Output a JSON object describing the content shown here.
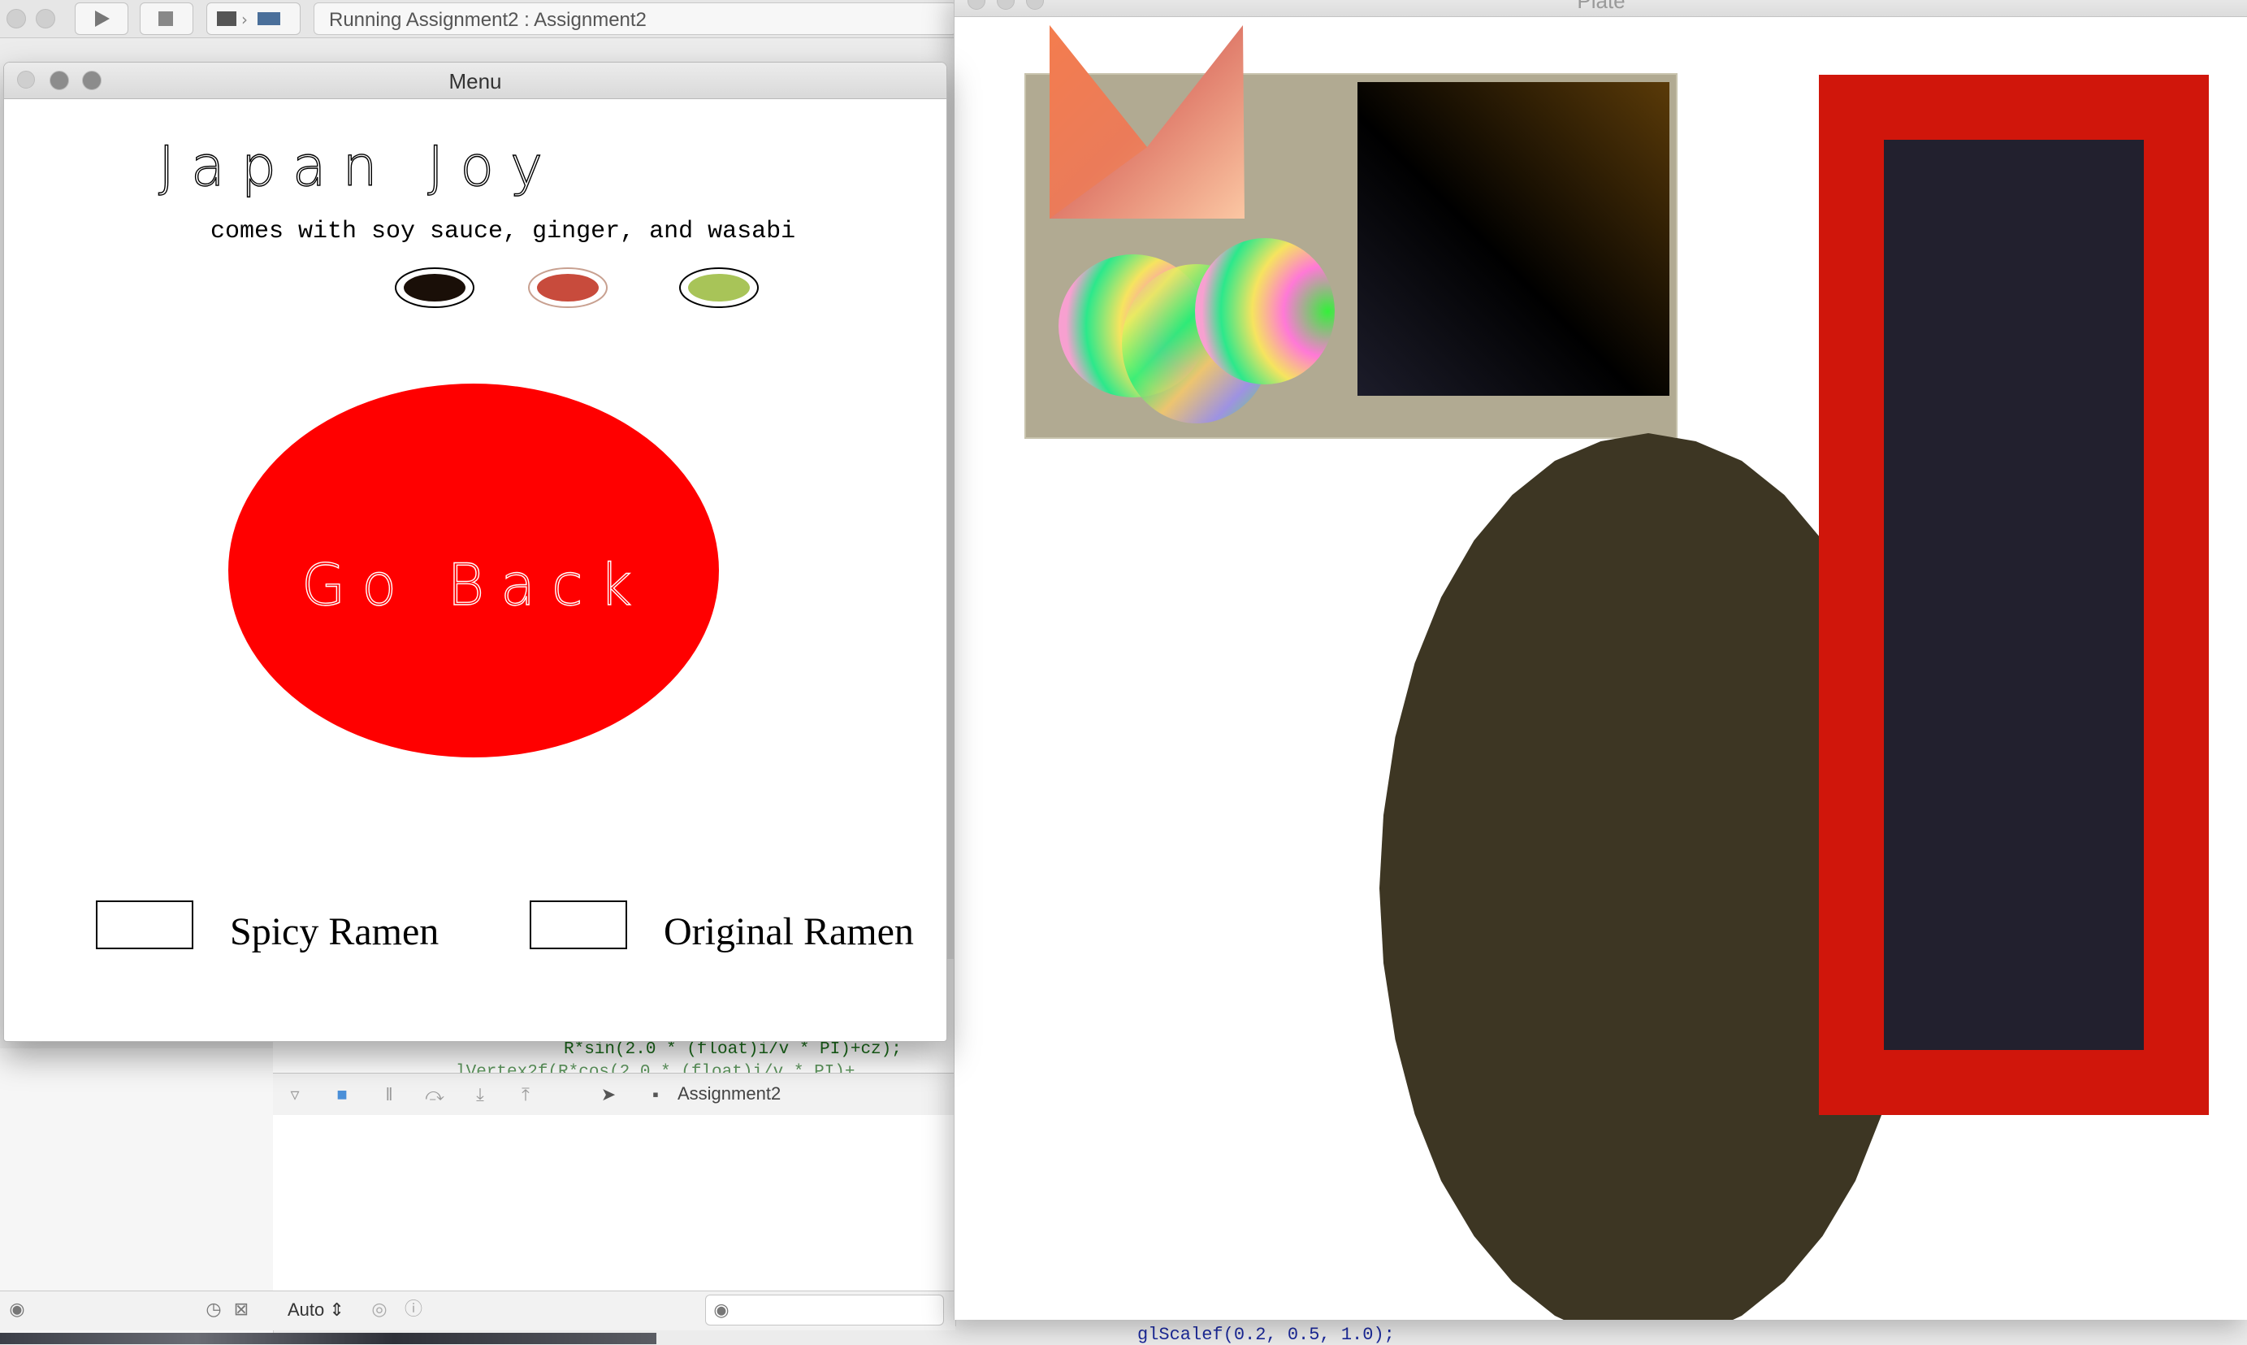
{
  "xcode": {
    "activity_text": "Running Assignment2 : Assignment2",
    "code_line_1": "R*sin(2.0 * (float)i/v * PI)+cz);",
    "code_line_2": "lVertex2f(R*cos(2.0 * (float)i/v * PI)+",
    "debug_target": "Assignment2",
    "auto_select": "Auto",
    "code_bottom": "glScalef(0.2, 0.5, 1.0);"
  },
  "menu_window": {
    "title": "Menu",
    "heading": "Japan Joy",
    "subtitle": "comes with soy sauce, ginger, and wasabi",
    "condiments": [
      {
        "name": "soy sauce",
        "color": "#1a0f08",
        "ring": "#000000"
      },
      {
        "name": "ginger",
        "color": "#c84b3c",
        "ring": "#d9b0a0"
      },
      {
        "name": "wasabi",
        "color": "#a8c458",
        "ring": "#000000"
      }
    ],
    "go_back_label": "Go Back",
    "go_back_color": "#ff0000",
    "options": [
      {
        "label": "Spicy Ramen",
        "checked": false
      },
      {
        "label": "Original Ramen",
        "checked": false
      }
    ]
  },
  "plate_window": {
    "title": "Plate",
    "tray_color": "#b1aa92",
    "bowl_color": "#3d3623",
    "chopstick_mat_outer": "#d0160b",
    "chopstick_mat_inner": "#22202e"
  }
}
